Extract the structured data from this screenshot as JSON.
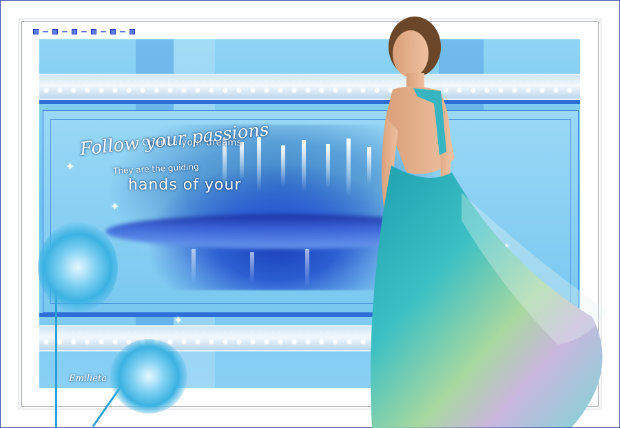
{
  "quote": {
    "line1": "Cherish your dreams",
    "line2": "Follow your passions",
    "line3": "They are the guiding",
    "line4": "hands of your"
  },
  "signature": "Emilieta",
  "colors": {
    "frame_border": "#3a4fb8",
    "panel_blue": "#6cc3ef",
    "deep_blue": "#1a3fb8",
    "dress_teal": "#2fb6b8",
    "lace_white": "#f3f8fc"
  },
  "icons": {
    "sparkle": "sparkle-icon",
    "dandelion": "dandelion-icon"
  }
}
